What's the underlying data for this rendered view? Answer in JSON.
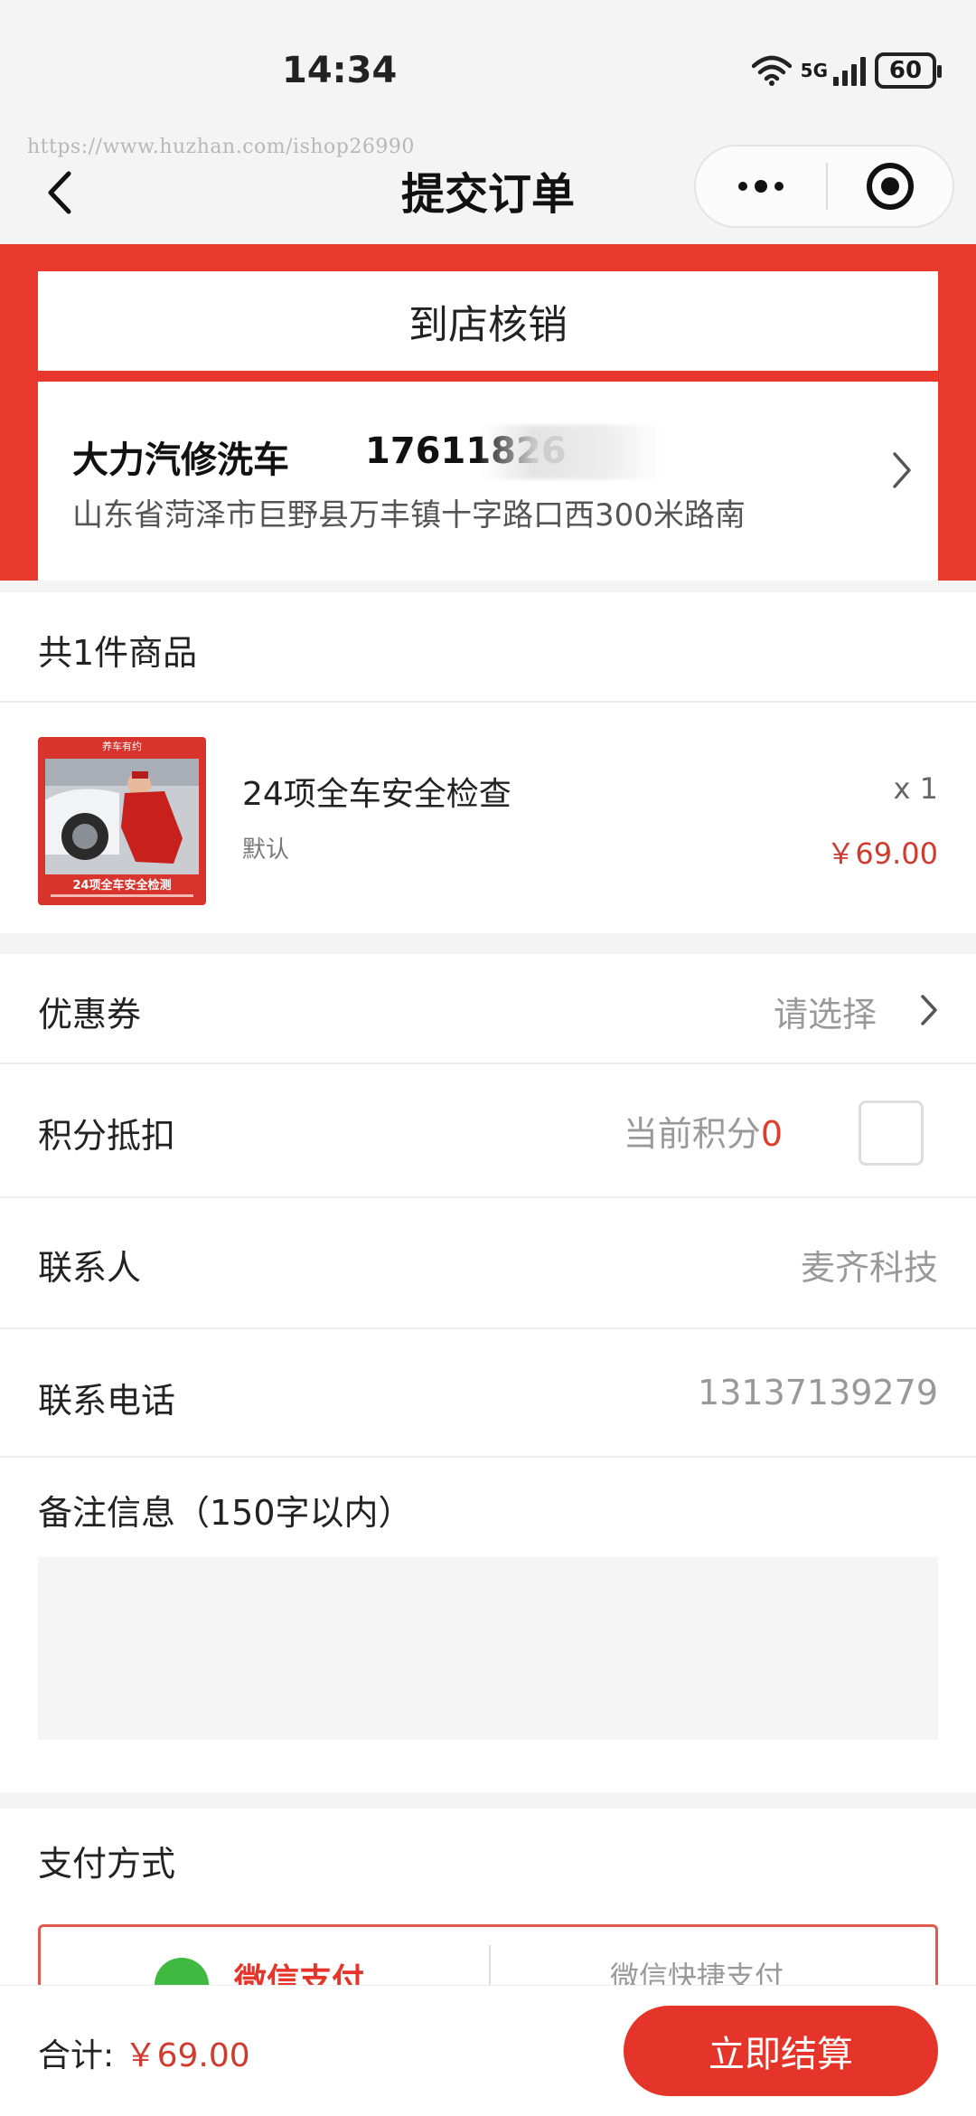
{
  "status_bar": {
    "time": "14:34",
    "network": "5G",
    "battery": "60"
  },
  "watermark": "https://www.huzhan.com/ishop26990",
  "nav": {
    "title": "提交订单"
  },
  "delivery_mode": "到店核销",
  "store": {
    "name": "大力汽修洗车",
    "phone": "17611826",
    "address": "山东省菏泽市巨野县万丰镇十字路口西300米路南"
  },
  "goods": {
    "count_label": "共1件商品",
    "items": [
      {
        "name": "24项全车安全检查",
        "spec": "默认",
        "quantity": "x 1",
        "price": "￥69.00",
        "thumb_badge": "养车有约",
        "thumb_caption": "24项全车安全检测"
      }
    ]
  },
  "coupon": {
    "label": "优惠券",
    "value": "请选择"
  },
  "points": {
    "label": "积分抵扣",
    "value_prefix": "当前积分",
    "value": "0"
  },
  "contact": {
    "label": "联系人",
    "value": "麦齐科技"
  },
  "phone": {
    "label": "联系电话",
    "value": "13137139279"
  },
  "remark": {
    "label": "备注信息（150字以内）",
    "placeholder": ""
  },
  "payment": {
    "label": "支付方式",
    "options": [
      "微信支付",
      "微信快捷支付"
    ]
  },
  "footer": {
    "total_label": "合计:",
    "total_value": "￥69.00",
    "submit": "立即结算"
  },
  "colors": {
    "accent": "#e5352a",
    "price": "#d23a2e",
    "background": "#f4f4f4"
  }
}
